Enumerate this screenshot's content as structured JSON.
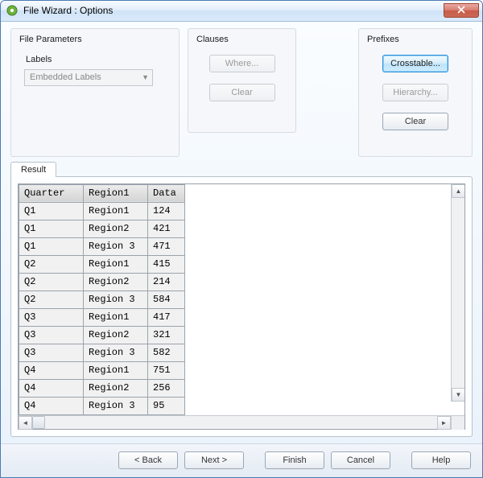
{
  "window": {
    "title": "File Wizard : Options"
  },
  "file_parameters": {
    "title": "File Parameters",
    "labels_label": "Labels",
    "labels_value": "Embedded Labels"
  },
  "clauses": {
    "title": "Clauses",
    "where_label": "Where...",
    "clear_label": "Clear"
  },
  "prefixes": {
    "title": "Prefixes",
    "crosstable_label": "Crosstable...",
    "hierarchy_label": "Hierarchy...",
    "clear_label": "Clear"
  },
  "result": {
    "tab_label": "Result",
    "columns": [
      "Quarter",
      "Region1",
      "Data"
    ],
    "rows": [
      [
        "Q1",
        "Region1",
        "124"
      ],
      [
        "Q1",
        "Region2",
        "421"
      ],
      [
        "Q1",
        "Region 3",
        "471"
      ],
      [
        "Q2",
        "Region1",
        "415"
      ],
      [
        "Q2",
        "Region2",
        "214"
      ],
      [
        "Q2",
        "Region 3",
        "584"
      ],
      [
        "Q3",
        "Region1",
        "417"
      ],
      [
        "Q3",
        "Region2",
        "321"
      ],
      [
        "Q3",
        "Region 3",
        "582"
      ],
      [
        "Q4",
        "Region1",
        "751"
      ],
      [
        "Q4",
        "Region2",
        "256"
      ],
      [
        "Q4",
        "Region 3",
        "95"
      ]
    ]
  },
  "footer": {
    "back": "< Back",
    "next": "Next >",
    "finish": "Finish",
    "cancel": "Cancel",
    "help": "Help"
  }
}
